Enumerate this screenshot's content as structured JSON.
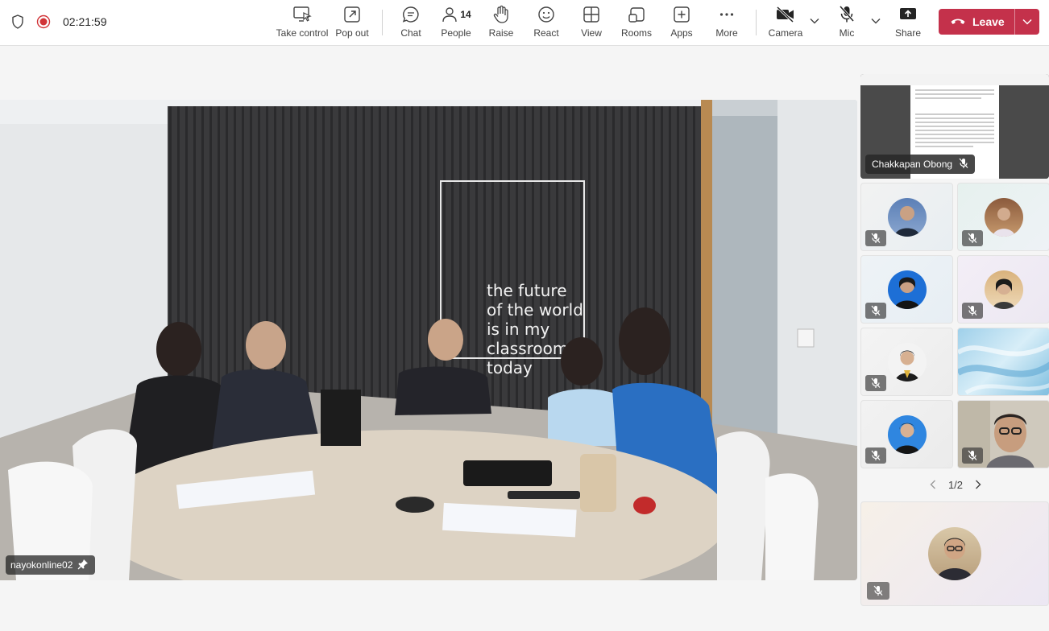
{
  "status": {
    "timer": "02:21:59"
  },
  "toolbar": {
    "take_control": "Take control",
    "pop_out": "Pop out",
    "chat": "Chat",
    "people": "People",
    "people_count": "14",
    "raise": "Raise",
    "react": "React",
    "view": "View",
    "rooms": "Rooms",
    "apps": "Apps",
    "more": "More",
    "camera": "Camera",
    "mic": "Mic",
    "share": "Share",
    "leave": "Leave"
  },
  "main_video": {
    "participant_name": "nayokonline02",
    "sign_text": [
      "the future",
      "of the world",
      "is in my",
      "classroom",
      "today"
    ]
  },
  "screen_share": {
    "presenter_name": "Chakkapan Obong"
  },
  "pager": {
    "label": "1/2"
  },
  "colors": {
    "leave_red": "#c4314b",
    "record_red": "#d13438"
  }
}
